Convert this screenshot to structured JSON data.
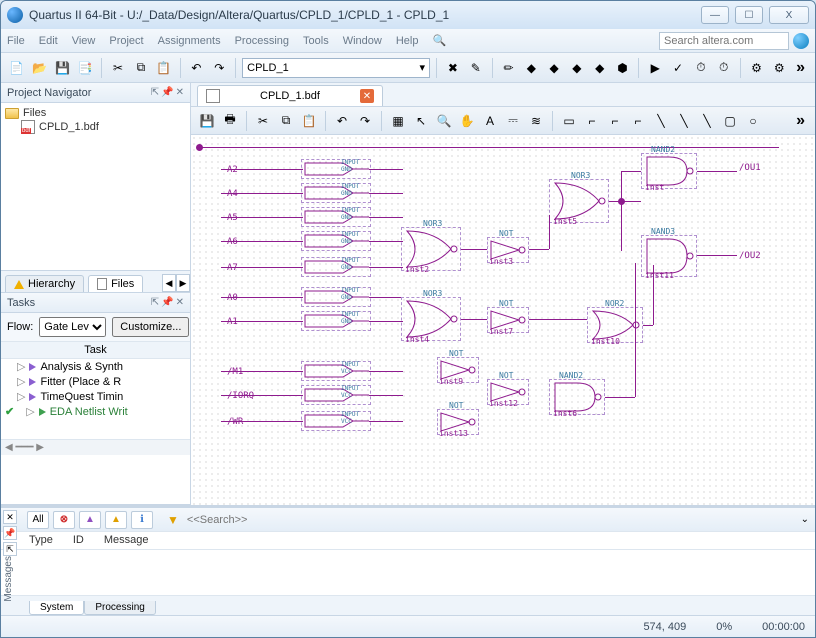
{
  "window": {
    "title": "Quartus II 64-Bit - U:/_Data/Design/Altera/Quartus/CPLD_1/CPLD_1 - CPLD_1",
    "min": "—",
    "max": "☐",
    "close": "X"
  },
  "menu": {
    "items": [
      "File",
      "Edit",
      "View",
      "Project",
      "Assignments",
      "Processing",
      "Tools",
      "Window",
      "Help"
    ],
    "search_placeholder": "Search altera.com"
  },
  "toolbar": {
    "project_combo": "CPLD_1"
  },
  "navigator": {
    "title": "Project Navigator",
    "folder": "Files",
    "file": "CPLD_1.bdf",
    "tab_hierarchy": "Hierarchy",
    "tab_files": "Files"
  },
  "tasks": {
    "title": "Tasks",
    "flow_label": "Flow:",
    "flow_value": "Gate Lev",
    "customize": "Customize...",
    "col": "Task",
    "items": [
      {
        "label": "Analysis & Synth",
        "ok": false
      },
      {
        "label": "Fitter (Place & R",
        "ok": false
      },
      {
        "label": "TimeQuest Timin",
        "ok": false
      },
      {
        "label": "EDA Netlist Writ",
        "ok": true
      }
    ]
  },
  "editor": {
    "tab": "CPLD_1.bdf"
  },
  "schematic": {
    "inputs": [
      "A2",
      "A4",
      "A5",
      "A6",
      "A7",
      "A0",
      "A1",
      "/M1",
      "/IORQ",
      "/WR"
    ],
    "input_type_gnd": "INPUT\nGND",
    "input_type_vcc": "INPUT\nVCC",
    "outputs": [
      "/OU1",
      "/OU2"
    ],
    "gates": [
      {
        "type": "NOR3",
        "inst": "inst2"
      },
      {
        "type": "NOR3",
        "inst": "inst4"
      },
      {
        "type": "NOR3",
        "inst": "inst5"
      },
      {
        "type": "NOT",
        "inst": "inst3"
      },
      {
        "type": "NOT",
        "inst": "inst7"
      },
      {
        "type": "NOT",
        "inst": "inst9"
      },
      {
        "type": "NOT",
        "inst": "inst12"
      },
      {
        "type": "NOT",
        "inst": "inst13"
      },
      {
        "type": "NOR2",
        "inst": "inst10"
      },
      {
        "type": "NAND2",
        "inst": "inst"
      },
      {
        "type": "NAND3",
        "inst": "inst11"
      },
      {
        "type": "NAND2",
        "inst": "inst6"
      }
    ]
  },
  "messages": {
    "all": "All",
    "search_hint": "<<Search>>",
    "cols": {
      "type": "Type",
      "id": "ID",
      "msg": "Message"
    },
    "tab_system": "System",
    "tab_processing": "Processing",
    "side_label": "Messages"
  },
  "status": {
    "coords": "574, 409",
    "pct": "0%",
    "time": "00:00:00"
  }
}
